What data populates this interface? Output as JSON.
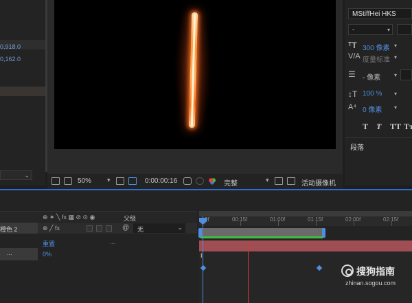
{
  "left_panel": {
    "coords": [
      "0,918.0",
      "0,162.0"
    ]
  },
  "viewer_toolbar": {
    "zoom": "50%",
    "timecode": "0:00:00:16",
    "resolution": "完整",
    "camera": "活动摄像机"
  },
  "character_panel": {
    "font_family": "MStiffHei HKS",
    "font_style": "-",
    "font_size": "300 像素",
    "kerning": "度量标准",
    "leading": "- 像素",
    "vertical_scale": "100 %",
    "baseline_shift": "0 像素",
    "style_buttons": [
      "T",
      "T",
      "TT",
      "Tт"
    ],
    "paragraph_tab": "段落"
  },
  "timeline": {
    "ruler_ticks": [
      "0f",
      "00:15f",
      "01:00f",
      "01:15f",
      "02:00f",
      "02:15f"
    ],
    "parent_header": "父级",
    "layer_name": "橙色 2",
    "parent_value": "无",
    "reset_label": "重置",
    "reset_dots": "...",
    "prop_dots": "...",
    "prop_value": "0%"
  },
  "watermark": {
    "title": "搜狗指南",
    "url": "zhinan.sogou.com"
  },
  "colors": {
    "accent_blue": "#4f8fe0",
    "layer_track": "#b5565c",
    "work_area_green": "#3fbf3f",
    "playhead_red": "#d23a3a"
  }
}
